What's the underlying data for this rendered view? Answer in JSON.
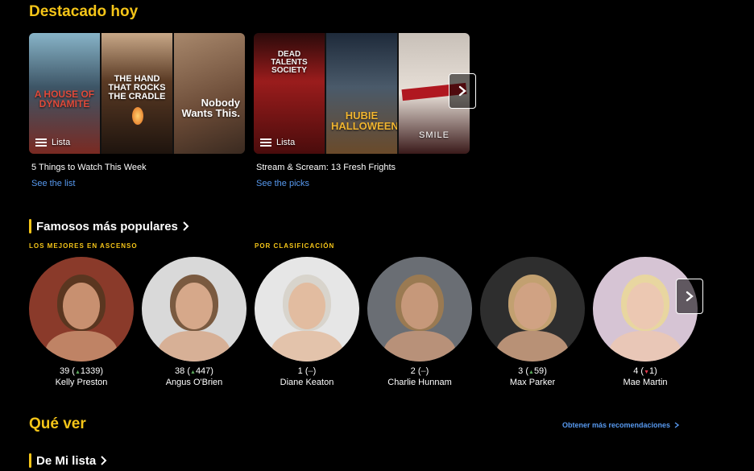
{
  "featured": {
    "title": "Destacado hoy",
    "cards": [
      {
        "caption": "5 Things to Watch This Week",
        "link": "See the list",
        "badge": "Lista",
        "posters": [
          {
            "text": "A HOUSE OF DYNAMITE",
            "bg": "#3d5566",
            "accent": "#c23a2c"
          },
          {
            "text": "THE HAND THAT ROCKS THE CRADLE",
            "bg": "#2a1c14",
            "accent": "#e58a2e"
          },
          {
            "text": "Nobody Wants This.",
            "bg": "#7a5a44",
            "accent": "#ffffff"
          }
        ]
      },
      {
        "caption": "Stream & Scream: 13 Fresh Frights",
        "link": "See the picks",
        "badge": "Lista",
        "posters": [
          {
            "text": "DEAD TALENTS SOCIETY",
            "bg": "#7b1a1a",
            "accent": "#f2f2f2"
          },
          {
            "text": "HUBIE HALLOWEEN",
            "bg": "#2b3a4f",
            "accent": "#f0b530"
          },
          {
            "text": "SMILE",
            "bg": "#d8d2cc",
            "accent": "#b01820"
          }
        ]
      }
    ]
  },
  "famosos": {
    "title": "Famosos más populares",
    "rising_label": "LOS MEJORES EN ASCENSO",
    "ranking_label": "POR CLASIFICACIÓN",
    "people": [
      {
        "rank": "39",
        "dir": "up",
        "change": "1339",
        "name": "Kelly Preston",
        "bg": "#8a3a2a",
        "skin": "#c89070",
        "hair": "#5a3620"
      },
      {
        "rank": "38",
        "dir": "up",
        "change": "447",
        "name": "Angus O'Brien",
        "bg": "#d9d9d9",
        "skin": "#d6a88a",
        "hair": "#7a5a40"
      },
      {
        "rank": "1",
        "dir": "none",
        "change": "–",
        "name": "Diane Keaton",
        "bg": "#e6e6e6",
        "skin": "#e2bca0",
        "hair": "#d8d4cc"
      },
      {
        "rank": "2",
        "dir": "none",
        "change": "–",
        "name": "Charlie Hunnam",
        "bg": "#6a6e74",
        "skin": "#c6987a",
        "hair": "#9a7a52"
      },
      {
        "rank": "3",
        "dir": "up",
        "change": "59",
        "name": "Max Parker",
        "bg": "#2e2e2e",
        "skin": "#d0a283",
        "hair": "#c2a070"
      },
      {
        "rank": "4",
        "dir": "down",
        "change": "1",
        "name": "Mae Martin",
        "bg": "#d6c4d4",
        "skin": "#ecc8b2",
        "hair": "#e8d6a0"
      }
    ]
  },
  "what_to_watch": {
    "title": "Qué ver",
    "recs_link": "Obtener más recomendaciones",
    "my_list": "De Mi lista"
  }
}
